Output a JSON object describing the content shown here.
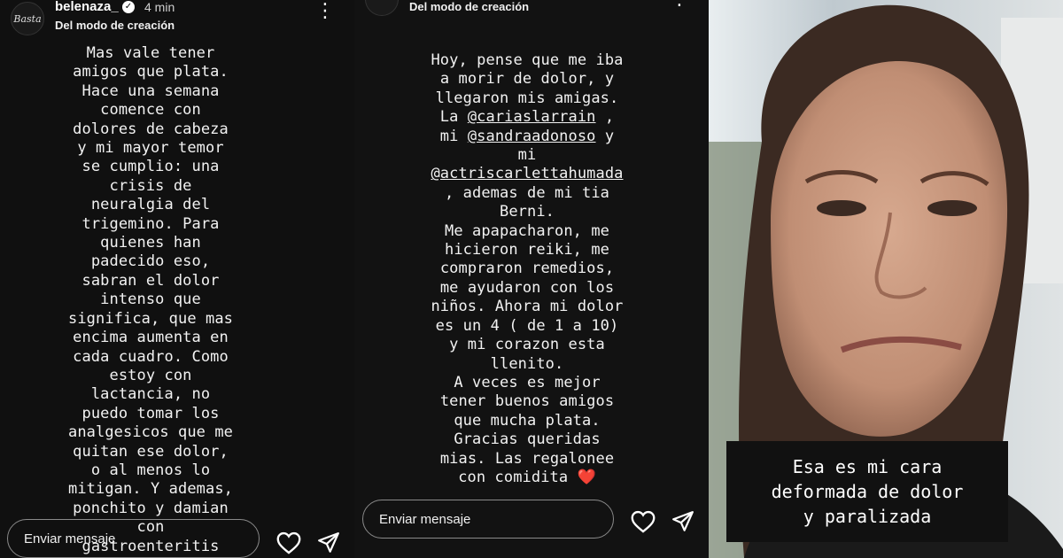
{
  "story1": {
    "username": "belenaza_",
    "time": "4 min",
    "mode_label": "Del modo de creación",
    "avatar_text": "Basta",
    "text": "Mas vale tener\namigos que plata.\nHace una semana\ncomence con\ndolores de cabeza\ny mi mayor temor\nse cumplio: una\ncrisis de\nneuralgia del\ntrigemino. Para\nquienes han\npadecido eso,\nsabran el dolor\nintenso que\nsignifica, que mas\nencima aumenta en\ncada cuadro. Como\nestoy con\nlactancia, no\npuedo tomar los\nanalgesicos que me\nquitan ese dolor,\no al menos lo\nmitigan. Y ademas,\nponchito y damian\ncon\ngastroenteritis",
    "message_placeholder": "Enviar mensaje"
  },
  "story2": {
    "mode_label": "Del modo de creación",
    "text_lines": [
      "Hoy, pense que me iba",
      "a morir de dolor, y",
      "llegaron mis amigas.",
      "La @cariaslarrain ,",
      "mi @sandraadonoso y",
      "mi",
      "@actriscarlettahumada",
      ", ademas de mi tia",
      "Berni.",
      "Me apapacharon, me",
      "hicieron reiki, me",
      "compraron remedios,",
      "me ayudaron con los",
      "niños. Ahora mi dolor",
      "es un 4 ( de 1 a 10)",
      "y mi corazon esta",
      "llenito.",
      "A veces es mejor",
      "tener buenos amigos",
      "que mucha plata.",
      "Gracias queridas",
      "mias. Las regalonee",
      "con comidita ❤️"
    ],
    "message_placeholder": "Enviar mensaje"
  },
  "story3": {
    "caption": "Esa es mi cara\ndeformada de dolor\ny paralizada"
  },
  "colors": {
    "story_bg": "#121212",
    "text": "#f2f2f2",
    "caption_bg": "#111111",
    "heart": "#e0182d"
  }
}
